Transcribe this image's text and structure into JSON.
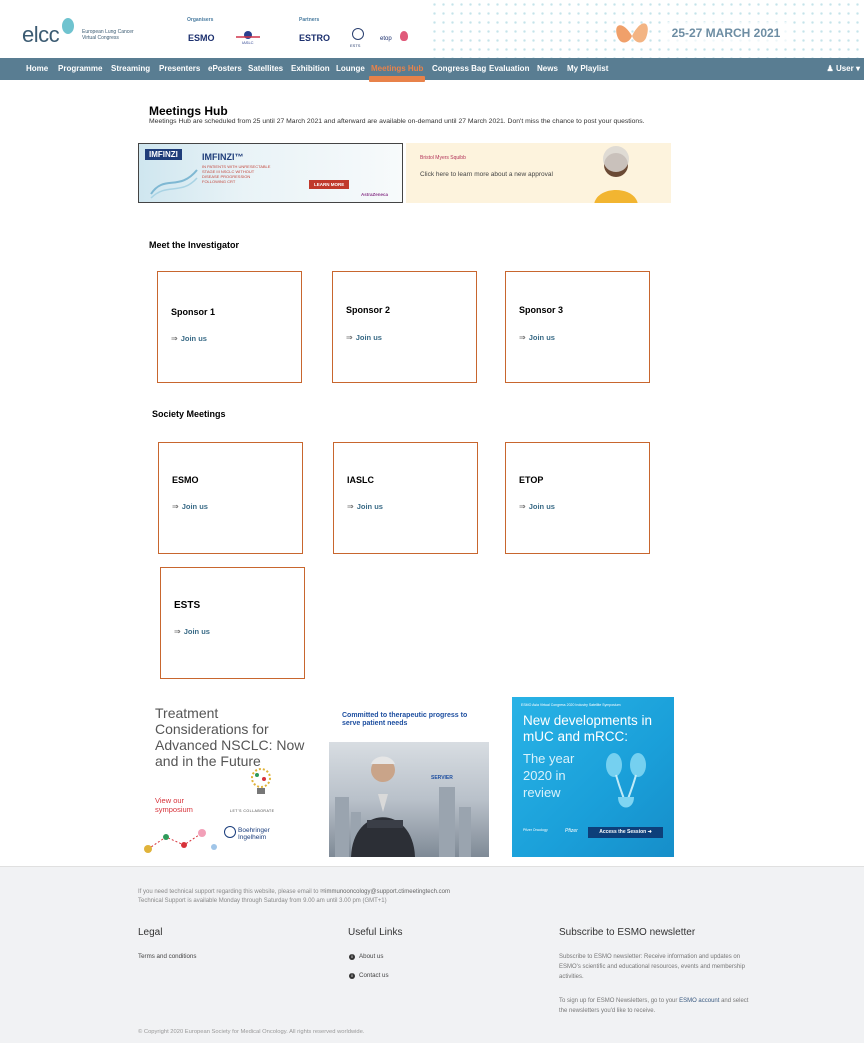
{
  "header": {
    "logo_text": "elcc",
    "logo_subtitle": "European Lung Cancer Virtual Congress",
    "organisers_label": "Organisers",
    "partners_label": "Partners",
    "org_esmo": "ESMO",
    "org_estro": "ESTRO",
    "org_ests": "ESTS",
    "org_etop": "etop",
    "date": "25-27 MARCH 2021"
  },
  "nav": {
    "items": [
      "Home",
      "Programme",
      "Streaming",
      "Presenters",
      "ePosters",
      "Satellites",
      "Exhibition",
      "Lounge",
      "Meetings Hub",
      "Congress Bag",
      "Evaluation",
      "News",
      "My Playlist"
    ],
    "active_index": 8,
    "user_label": "User"
  },
  "main": {
    "title": "Meetings Hub",
    "subtitle": "Meetings Hub are scheduled from 25 until 27 March 2021 and afterward are available on-demand until 27 March 2021. Don't miss the chance to post your questions."
  },
  "banners": {
    "imfinzi": {
      "brand": "IMFINZI",
      "headline": "IMFINZI™",
      "lines": "IN PATIENTS WITH UNRESECTABLE STAGE III NSCLC WITHOUT DISEASE PROGRESSION FOLLOWING CRT",
      "button": "LEARN MORE",
      "company": "AstraZeneca"
    },
    "bms": {
      "brand": "Bristol Myers Squibb",
      "cta": "Click here to learn more about a new approval"
    }
  },
  "investigator": {
    "title": "Meet the Investigator",
    "join_label": "Join us",
    "cards": [
      "Sponsor 1",
      "Sponsor 2",
      "Sponsor 3"
    ]
  },
  "society": {
    "title": "Society Meetings",
    "join_label": "Join us",
    "cards": [
      "ESMO",
      "IASLC",
      "ETOP",
      "ESTS"
    ]
  },
  "ads": {
    "ad1": {
      "headline": "Treatment Considerations for Advanced NSCLC: Now and in the Future",
      "cta": "View our symposium",
      "collab": "LET'S COLLABORATE",
      "company": "Boehringer Ingelheim"
    },
    "ad2": {
      "headline": "Committed to therapeutic progress to serve patient needs",
      "company": "SERVIER"
    },
    "ad3": {
      "top": "ESMO Asia Virtual Congress 2020 Industry Satellite Symposium",
      "headline": "New developments in mUC and mRCC:",
      "year_text": "The year 2020 in review",
      "cta": "Access the Session",
      "company": "Pfizer"
    }
  },
  "footer": {
    "support_line1_prefix": "If you need technical support regarding this website, please email to",
    "support_email": "immunooncology@support.ctimeetingtech.com",
    "support_line2": "Technical Support is available Monday through Saturday from 9.00 am until 3.00 pm (GMT+1)",
    "legal_title": "Legal",
    "legal_item": "Terms and conditions",
    "links_title": "Useful Links",
    "links": [
      "About us",
      "Contact us"
    ],
    "newsletter_title": "Subscribe to ESMO newsletter",
    "newsletter_text1": "Subscribe to ESMO newsletter: Receive information and updates on ESMO's scientific and educational resources, events and membership activities.",
    "newsletter_text2_prefix": "To sign up for ESMO Newsletters, go to your",
    "newsletter_link": "ESMO account",
    "newsletter_text2_suffix": "and select the newsletters you'd like to receive.",
    "copyright": "© Copyright 2020 European Society for Medical Oncology. All rights reserved worldwide."
  }
}
